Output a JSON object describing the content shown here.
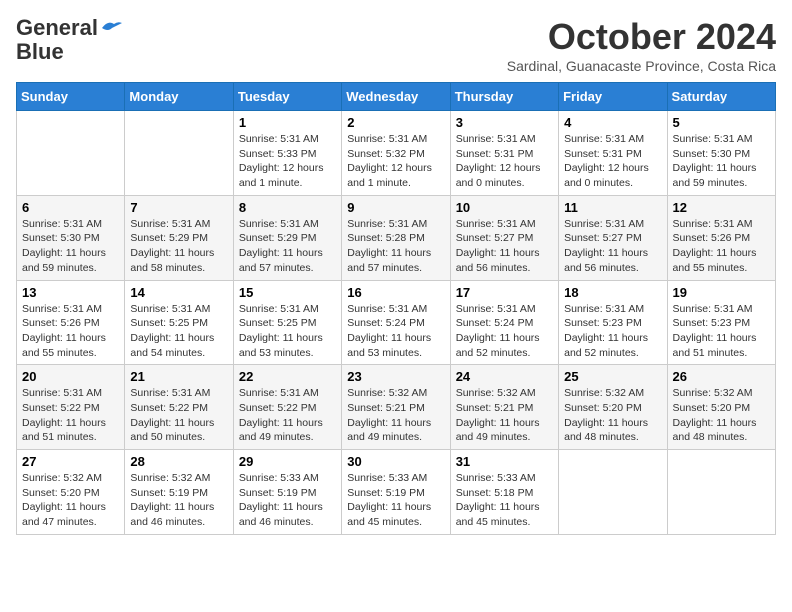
{
  "header": {
    "logo_line1": "General",
    "logo_line2": "Blue",
    "month": "October 2024",
    "location": "Sardinal, Guanacaste Province, Costa Rica"
  },
  "weekdays": [
    "Sunday",
    "Monday",
    "Tuesday",
    "Wednesday",
    "Thursday",
    "Friday",
    "Saturday"
  ],
  "weeks": [
    [
      {
        "day": "",
        "content": ""
      },
      {
        "day": "",
        "content": ""
      },
      {
        "day": "1",
        "content": "Sunrise: 5:31 AM\nSunset: 5:33 PM\nDaylight: 12 hours\nand 1 minute."
      },
      {
        "day": "2",
        "content": "Sunrise: 5:31 AM\nSunset: 5:32 PM\nDaylight: 12 hours\nand 1 minute."
      },
      {
        "day": "3",
        "content": "Sunrise: 5:31 AM\nSunset: 5:31 PM\nDaylight: 12 hours\nand 0 minutes."
      },
      {
        "day": "4",
        "content": "Sunrise: 5:31 AM\nSunset: 5:31 PM\nDaylight: 12 hours\nand 0 minutes."
      },
      {
        "day": "5",
        "content": "Sunrise: 5:31 AM\nSunset: 5:30 PM\nDaylight: 11 hours\nand 59 minutes."
      }
    ],
    [
      {
        "day": "6",
        "content": "Sunrise: 5:31 AM\nSunset: 5:30 PM\nDaylight: 11 hours\nand 59 minutes."
      },
      {
        "day": "7",
        "content": "Sunrise: 5:31 AM\nSunset: 5:29 PM\nDaylight: 11 hours\nand 58 minutes."
      },
      {
        "day": "8",
        "content": "Sunrise: 5:31 AM\nSunset: 5:29 PM\nDaylight: 11 hours\nand 57 minutes."
      },
      {
        "day": "9",
        "content": "Sunrise: 5:31 AM\nSunset: 5:28 PM\nDaylight: 11 hours\nand 57 minutes."
      },
      {
        "day": "10",
        "content": "Sunrise: 5:31 AM\nSunset: 5:27 PM\nDaylight: 11 hours\nand 56 minutes."
      },
      {
        "day": "11",
        "content": "Sunrise: 5:31 AM\nSunset: 5:27 PM\nDaylight: 11 hours\nand 56 minutes."
      },
      {
        "day": "12",
        "content": "Sunrise: 5:31 AM\nSunset: 5:26 PM\nDaylight: 11 hours\nand 55 minutes."
      }
    ],
    [
      {
        "day": "13",
        "content": "Sunrise: 5:31 AM\nSunset: 5:26 PM\nDaylight: 11 hours\nand 55 minutes."
      },
      {
        "day": "14",
        "content": "Sunrise: 5:31 AM\nSunset: 5:25 PM\nDaylight: 11 hours\nand 54 minutes."
      },
      {
        "day": "15",
        "content": "Sunrise: 5:31 AM\nSunset: 5:25 PM\nDaylight: 11 hours\nand 53 minutes."
      },
      {
        "day": "16",
        "content": "Sunrise: 5:31 AM\nSunset: 5:24 PM\nDaylight: 11 hours\nand 53 minutes."
      },
      {
        "day": "17",
        "content": "Sunrise: 5:31 AM\nSunset: 5:24 PM\nDaylight: 11 hours\nand 52 minutes."
      },
      {
        "day": "18",
        "content": "Sunrise: 5:31 AM\nSunset: 5:23 PM\nDaylight: 11 hours\nand 52 minutes."
      },
      {
        "day": "19",
        "content": "Sunrise: 5:31 AM\nSunset: 5:23 PM\nDaylight: 11 hours\nand 51 minutes."
      }
    ],
    [
      {
        "day": "20",
        "content": "Sunrise: 5:31 AM\nSunset: 5:22 PM\nDaylight: 11 hours\nand 51 minutes."
      },
      {
        "day": "21",
        "content": "Sunrise: 5:31 AM\nSunset: 5:22 PM\nDaylight: 11 hours\nand 50 minutes."
      },
      {
        "day": "22",
        "content": "Sunrise: 5:31 AM\nSunset: 5:22 PM\nDaylight: 11 hours\nand 49 minutes."
      },
      {
        "day": "23",
        "content": "Sunrise: 5:32 AM\nSunset: 5:21 PM\nDaylight: 11 hours\nand 49 minutes."
      },
      {
        "day": "24",
        "content": "Sunrise: 5:32 AM\nSunset: 5:21 PM\nDaylight: 11 hours\nand 49 minutes."
      },
      {
        "day": "25",
        "content": "Sunrise: 5:32 AM\nSunset: 5:20 PM\nDaylight: 11 hours\nand 48 minutes."
      },
      {
        "day": "26",
        "content": "Sunrise: 5:32 AM\nSunset: 5:20 PM\nDaylight: 11 hours\nand 48 minutes."
      }
    ],
    [
      {
        "day": "27",
        "content": "Sunrise: 5:32 AM\nSunset: 5:20 PM\nDaylight: 11 hours\nand 47 minutes."
      },
      {
        "day": "28",
        "content": "Sunrise: 5:32 AM\nSunset: 5:19 PM\nDaylight: 11 hours\nand 46 minutes."
      },
      {
        "day": "29",
        "content": "Sunrise: 5:33 AM\nSunset: 5:19 PM\nDaylight: 11 hours\nand 46 minutes."
      },
      {
        "day": "30",
        "content": "Sunrise: 5:33 AM\nSunset: 5:19 PM\nDaylight: 11 hours\nand 45 minutes."
      },
      {
        "day": "31",
        "content": "Sunrise: 5:33 AM\nSunset: 5:18 PM\nDaylight: 11 hours\nand 45 minutes."
      },
      {
        "day": "",
        "content": ""
      },
      {
        "day": "",
        "content": ""
      }
    ]
  ]
}
